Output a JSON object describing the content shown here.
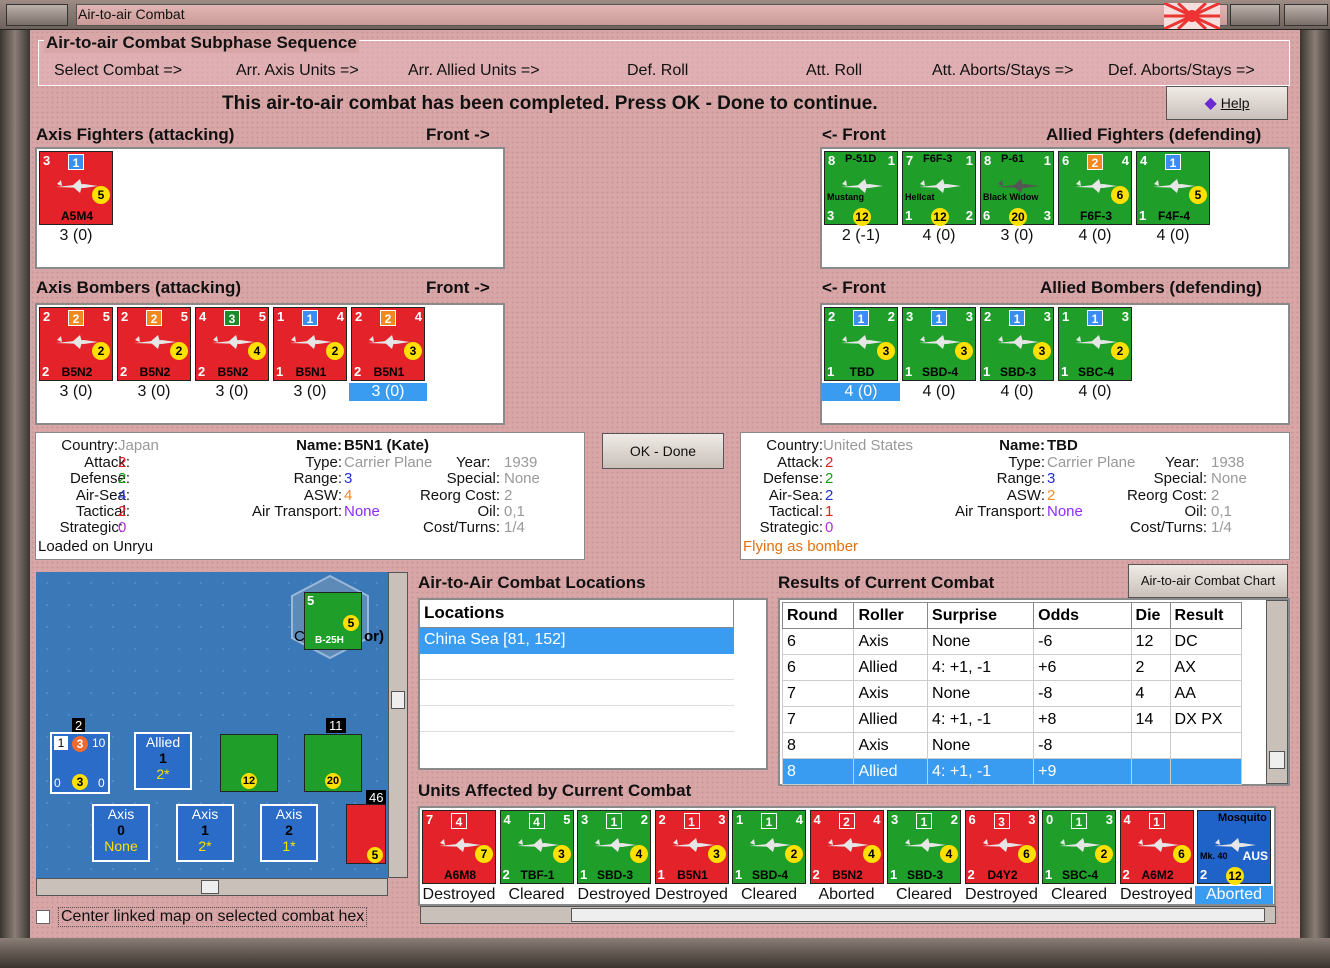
{
  "window": {
    "title": "Air-to-air Combat"
  },
  "sequence": {
    "title": "Air-to-air Combat Subphase Sequence",
    "steps": [
      "Select Combat =>",
      "Arr. Axis Units =>",
      "Arr. Allied Units =>",
      "Def. Roll",
      "Att. Roll",
      "Att. Aborts/Stays =>",
      "Def. Aborts/Stays =>"
    ]
  },
  "status": "This air-to-air combat has been completed.  Press OK - Done to continue.",
  "help_label": "Help",
  "panels": {
    "axis_fighters": {
      "title": "Axis Fighters (attacking)",
      "front": "Front ->",
      "units": [
        {
          "top": "3",
          "badge": "1",
          "badge_color": "bb",
          "coin": "5",
          "name": "A5M4",
          "value": "3 (0)"
        }
      ]
    },
    "allied_fighters": {
      "title": "Allied Fighters (defending)",
      "front": "<- Front",
      "units": [
        {
          "top": "8",
          "tag": "P-51D",
          "tr": "1",
          "sub": "Mustang",
          "bl": "3",
          "coin": "12",
          "name": "",
          "value": "2 (-1)"
        },
        {
          "top": "7",
          "tag": "F6F-3",
          "tr": "1",
          "sub": "Hellcat",
          "bl": "1",
          "br": "2",
          "coin": "12",
          "name": "",
          "value": "4 (0)"
        },
        {
          "top": "8",
          "tag": "P-61",
          "tr": "1",
          "sub": "Black Widow",
          "bl": "6",
          "br": "3",
          "coin": "20",
          "name": "",
          "value": "3 (0)",
          "dark": true
        },
        {
          "top": "6",
          "badge": "2",
          "badge_color": "bo",
          "tr": "4",
          "coin": "6",
          "name": "F6F-3",
          "value": "4 (0)"
        },
        {
          "top": "4",
          "badge": "1",
          "badge_color": "bb",
          "coin": "5",
          "bl": "1",
          "name": "F4F-4",
          "value": "4 (0)"
        }
      ]
    },
    "axis_bombers": {
      "title": "Axis Bombers (attacking)",
      "front": "Front ->",
      "units": [
        {
          "top": "2",
          "badge": "2",
          "badge_color": "bo",
          "tr": "5",
          "bl": "2",
          "coin": "2",
          "name": "B5N2",
          "value": "3 (0)"
        },
        {
          "top": "2",
          "badge": "2",
          "badge_color": "bo",
          "tr": "5",
          "bl": "2",
          "coin": "2",
          "name": "B5N2",
          "value": "3 (0)"
        },
        {
          "top": "4",
          "badge": "3",
          "badge_color": "bg",
          "tr": "5",
          "bl": "2",
          "coin": "4",
          "name": "B5N2",
          "value": "3 (0)"
        },
        {
          "top": "1",
          "badge": "1",
          "badge_color": "bb",
          "tr": "4",
          "bl": "1",
          "coin": "2",
          "name": "B5N1",
          "value": "3 (0)"
        },
        {
          "top": "2",
          "badge": "2",
          "badge_color": "bo",
          "tr": "4",
          "bl": "2",
          "coin": "3",
          "name": "B5N1",
          "value": "3 (0)",
          "selected": true
        }
      ]
    },
    "allied_bombers": {
      "title": "Allied Bombers (defending)",
      "front": "<- Front",
      "units": [
        {
          "top": "2",
          "badge": "1",
          "badge_color": "bb",
          "tr": "2",
          "bl": "1",
          "coin": "3",
          "name": "TBD",
          "value": "4 (0)",
          "selected": true
        },
        {
          "top": "3",
          "badge": "1",
          "badge_color": "bb",
          "tr": "3",
          "bl": "1",
          "coin": "3",
          "name": "SBD-4",
          "value": "4 (0)"
        },
        {
          "top": "2",
          "badge": "1",
          "badge_color": "bb",
          "tr": "3",
          "bl": "1",
          "coin": "3",
          "name": "SBD-3",
          "value": "4 (0)"
        },
        {
          "top": "1",
          "badge": "1",
          "badge_color": "bb",
          "tr": "3",
          "bl": "1",
          "coin": "2",
          "name": "SBC-4",
          "value": "4 (0)"
        }
      ]
    }
  },
  "axis_info": {
    "country_l": "Country:",
    "country": "Japan",
    "attack_l": "Attack:",
    "attack": "2",
    "defense_l": "Defense:",
    "defense": "2",
    "airsea_l": "Air-Sea:",
    "airsea": "4",
    "tactical_l": "Tactical:",
    "tactical": "2",
    "strategic_l": "Strategic:",
    "strategic": "0",
    "loaded": "Loaded on Unryu",
    "name_l": "Name:",
    "name": "B5N1 (Kate)",
    "type_l": "Type:",
    "type": "Carrier Plane",
    "year_l": "Year:",
    "year": "1939",
    "range_l": "Range:",
    "range": "3",
    "special_l": "Special:",
    "special": "None",
    "asw_l": "ASW:",
    "asw": "4",
    "reorg_l": "Reorg Cost:",
    "reorg": "2",
    "transport_l": "Air Transport:",
    "transport": "None",
    "oil_l": "Oil:",
    "oil": "0,1",
    "cost_l": "Cost/Turns:",
    "cost": "1/4"
  },
  "allied_info": {
    "country_l": "Country:",
    "country": "United States",
    "attack_l": "Attack:",
    "attack": "2",
    "defense_l": "Defense:",
    "defense": "2",
    "airsea_l": "Air-Sea:",
    "airsea": "2",
    "tactical_l": "Tactical:",
    "tactical": "1",
    "strategic_l": "Strategic:",
    "strategic": "0",
    "flying": "Flying as bomber",
    "name_l": "Name:",
    "name": "TBD",
    "type_l": "Type:",
    "type": "Carrier Plane",
    "year_l": "Year:",
    "year": "1938",
    "range_l": "Range:",
    "range": "3",
    "special_l": "Special:",
    "special": "None",
    "asw_l": "ASW:",
    "asw": "2",
    "reorg_l": "Reorg Cost:",
    "reorg": "2",
    "transport_l": "Air Transport:",
    "transport": "None",
    "oil_l": "Oil:",
    "oil": "0,1",
    "cost_l": "Cost/Turns:",
    "cost": "1/4"
  },
  "ok_label": "OK - Done",
  "map": {
    "hex_top": "5",
    "hex_coin": "5",
    "hex_tag": "B-25H",
    "hex_label_l": "C",
    "hex_label_r": "or)",
    "counters": [
      {
        "title": "Allied",
        "val": "1",
        "sub": "2*"
      },
      {
        "title": "Axis",
        "val": "0",
        "sub": "None"
      },
      {
        "title": "Axis",
        "val": "1",
        "sub": "2*"
      },
      {
        "title": "Axis",
        "val": "2",
        "sub": "1*"
      }
    ],
    "stack_counts": [
      "2",
      "11",
      "46"
    ],
    "navy": [
      "1",
      "3",
      "10",
      "0",
      "3",
      "0"
    ]
  },
  "locations": {
    "title": "Air-to-Air Combat Locations",
    "header": "Locations",
    "items": [
      "China Sea [81, 152]"
    ]
  },
  "results": {
    "title": "Results of Current Combat",
    "chart_btn": "Air-to-air Combat Chart",
    "headers": [
      "Round",
      "Roller",
      "Surprise",
      "Odds",
      "Die",
      "Result"
    ],
    "rows": [
      [
        "6",
        "Axis",
        "None",
        "-6",
        "12",
        "DC"
      ],
      [
        "6",
        "Allied",
        "4: +1, -1",
        "+6",
        "2",
        "AX"
      ],
      [
        "7",
        "Axis",
        "None",
        "-8",
        "4",
        "AA"
      ],
      [
        "7",
        "Allied",
        "4: +1, -1",
        "+8",
        "14",
        "DX PX"
      ],
      [
        "8",
        "Axis",
        "None",
        "-8",
        "",
        ""
      ],
      [
        "8",
        "Allied",
        "4: +1, -1",
        "+9",
        "",
        ""
      ]
    ]
  },
  "affected": {
    "title": "Units Affected by Current Combat",
    "units": [
      {
        "color": "red",
        "top": "7",
        "badge": "4",
        "coin": "7",
        "name": "A6M8",
        "status": "Destroyed"
      },
      {
        "color": "grn",
        "top": "4",
        "badge": "4",
        "coin": "3",
        "name": "TBF-1",
        "status": "Cleared",
        "bl": "2",
        "tr": "5"
      },
      {
        "color": "grn",
        "top": "3",
        "badge": "1",
        "coin": "4",
        "name": "SBD-3",
        "status": "Destroyed",
        "bl": "1",
        "tr": "2"
      },
      {
        "color": "red",
        "top": "2",
        "badge": "1",
        "coin": "3",
        "name": "B5N1",
        "status": "Destroyed",
        "bl": "1",
        "tr": "3"
      },
      {
        "color": "grn",
        "top": "1",
        "badge": "1",
        "coin": "2",
        "name": "SBD-4",
        "status": "Cleared",
        "bl": "1",
        "tr": "4"
      },
      {
        "color": "red",
        "top": "4",
        "badge": "2",
        "coin": "4",
        "name": "B5N2",
        "status": "Aborted",
        "bl": "2",
        "tr": "4"
      },
      {
        "color": "grn",
        "top": "3",
        "badge": "1",
        "coin": "4",
        "name": "SBD-3",
        "status": "Cleared",
        "bl": "1",
        "tr": "2"
      },
      {
        "color": "red",
        "top": "6",
        "badge": "3",
        "coin": "6",
        "name": "D4Y2",
        "status": "Destroyed",
        "bl": "2",
        "tr": "3"
      },
      {
        "color": "grn",
        "top": "0",
        "badge": "1",
        "coin": "2",
        "name": "SBC-4",
        "status": "Cleared",
        "bl": "1",
        "tr": "3"
      },
      {
        "color": "red",
        "top": "4",
        "badge": "1",
        "coin": "6",
        "name": "A6M2",
        "status": "Destroyed",
        "bl": "2"
      },
      {
        "color": "blu",
        "top": "",
        "tag": "Mosquito",
        "sub": "Mk. 40",
        "aus": "AUS",
        "bl": "2",
        "coin": "12",
        "name": "",
        "status": "Aborted",
        "selected": true
      }
    ]
  },
  "center_checkbox": "Center linked map on selected combat hex",
  "colors": {
    "background": "#d9a6a8",
    "axis": "#e3222a",
    "allied": "#1f9e2a",
    "selection": "#3a9cf0"
  }
}
